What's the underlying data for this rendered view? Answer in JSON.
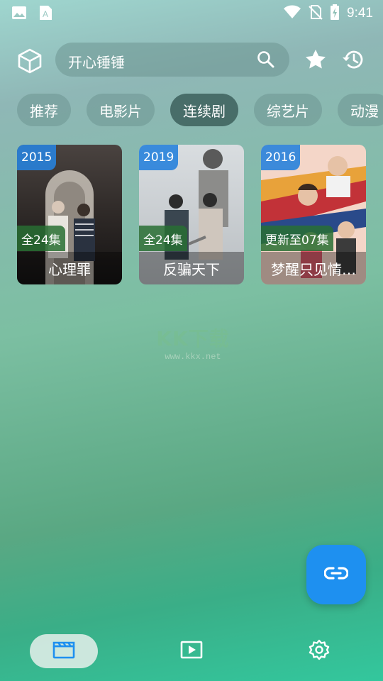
{
  "status_bar": {
    "time": "9:41",
    "left_icons": [
      "image-icon",
      "font-icon"
    ],
    "right_icons": [
      "wifi-icon",
      "no-sim-icon",
      "battery-charging-icon"
    ]
  },
  "header": {
    "logo_icon": "cube-icon",
    "search": {
      "value": "开心锤锤",
      "icon": "search-icon"
    },
    "favorites_icon": "star-icon",
    "history_icon": "history-icon"
  },
  "categories": [
    {
      "label": "推荐",
      "active": false
    },
    {
      "label": "电影片",
      "active": false
    },
    {
      "label": "连续剧",
      "active": true
    },
    {
      "label": "综艺片",
      "active": false
    },
    {
      "label": "动漫",
      "active": false
    }
  ],
  "cards": [
    {
      "year": "2015",
      "episodes": "全24集",
      "title": "心理罪"
    },
    {
      "year": "2019",
      "episodes": "全24集",
      "title": "反骗天下"
    },
    {
      "year": "2016",
      "episodes": "更新至07集",
      "title": "梦醒只见情…"
    }
  ],
  "watermark": {
    "logo": "KK下载",
    "url": "www.kkx.net"
  },
  "fab": {
    "icon": "link-icon"
  },
  "bottom_nav": [
    {
      "icon": "clapperboard-icon",
      "active": true
    },
    {
      "icon": "play-box-icon",
      "active": false
    },
    {
      "icon": "gear-icon",
      "active": false
    }
  ],
  "colors": {
    "accent": "#1e90f0",
    "year_badge": "#2882dc",
    "episode_badge": "#286e32"
  }
}
